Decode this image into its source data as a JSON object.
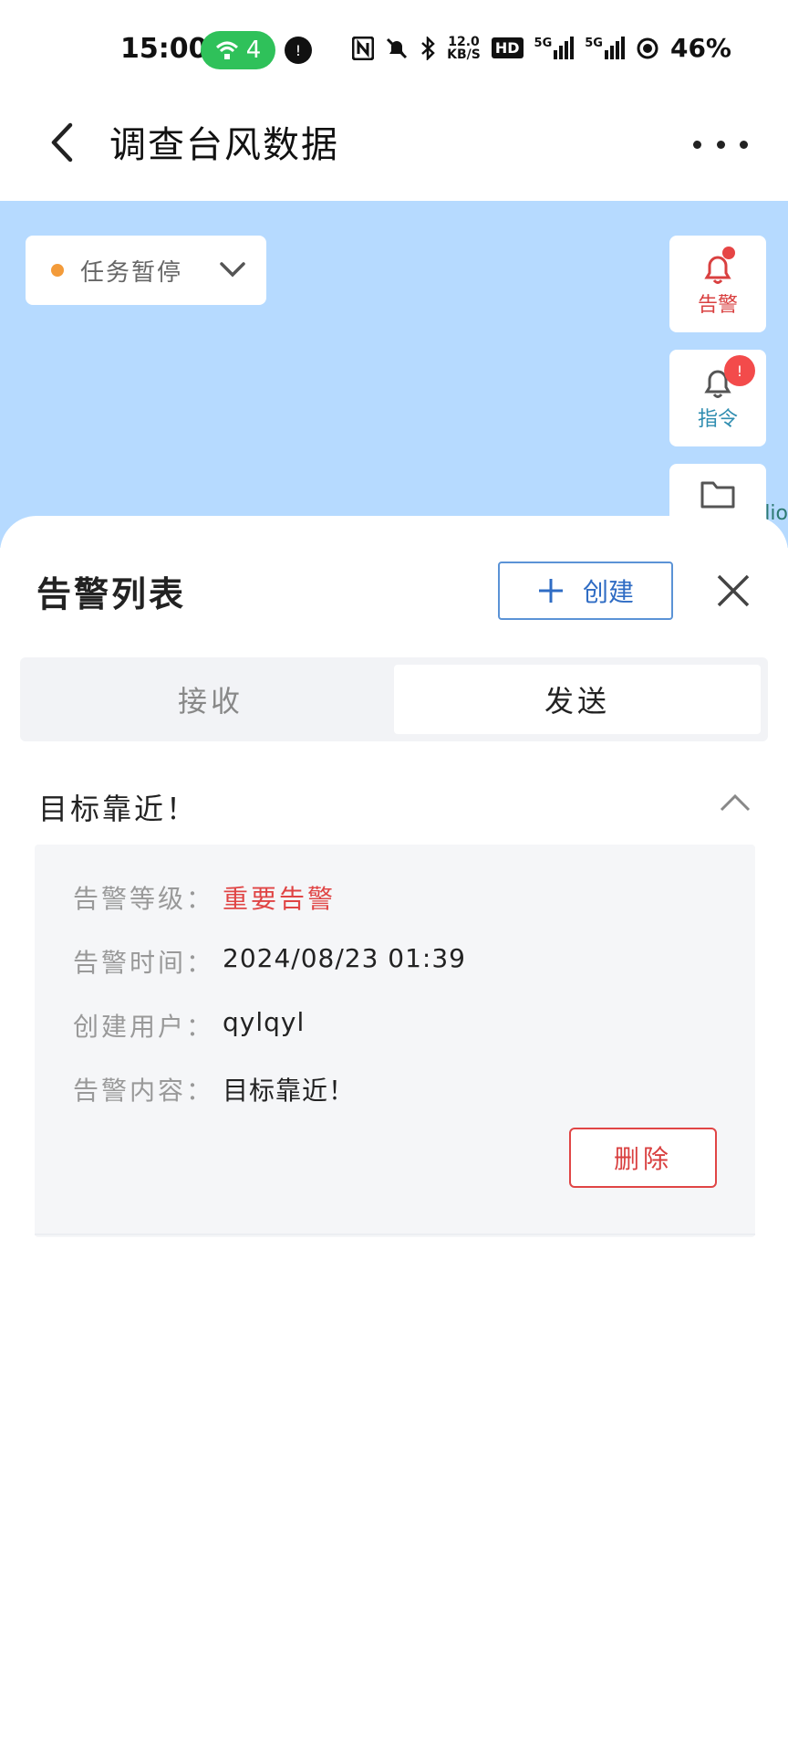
{
  "status_bar": {
    "time": "15:00",
    "hotspot_count": "4",
    "dot_label": "!",
    "network_speed_top": "12.0",
    "network_speed_bottom": "KB/S",
    "hd_label": "HD",
    "signal1_label": "5G",
    "signal2_label": "5G",
    "battery": "46%"
  },
  "header": {
    "title": "调查台风数据"
  },
  "map": {
    "task_status_label": "任务暂停",
    "task_status_color": "#f39b3a",
    "alarm_button_label": "告警",
    "alarm_color": "#d94040",
    "command_button_label": "指令",
    "command_badge": "!",
    "command_color": "#2f8db0",
    "edge_text": "lio"
  },
  "sheet": {
    "title": "告警列表",
    "create_label": "创建",
    "tabs": [
      {
        "label": "接收"
      },
      {
        "label": "发送"
      }
    ],
    "active_tab": "发送",
    "alert": {
      "title": "目标靠近！",
      "level_key": "告警等级：",
      "level_value": "重要告警",
      "time_key": "告警时间：",
      "time_value": "2024/08/23 01:39",
      "user_key": "创建用户：",
      "user_value": "qylqyl",
      "content_key": "告警内容：",
      "content_value": "目标靠近！",
      "delete_label": "删除"
    }
  }
}
